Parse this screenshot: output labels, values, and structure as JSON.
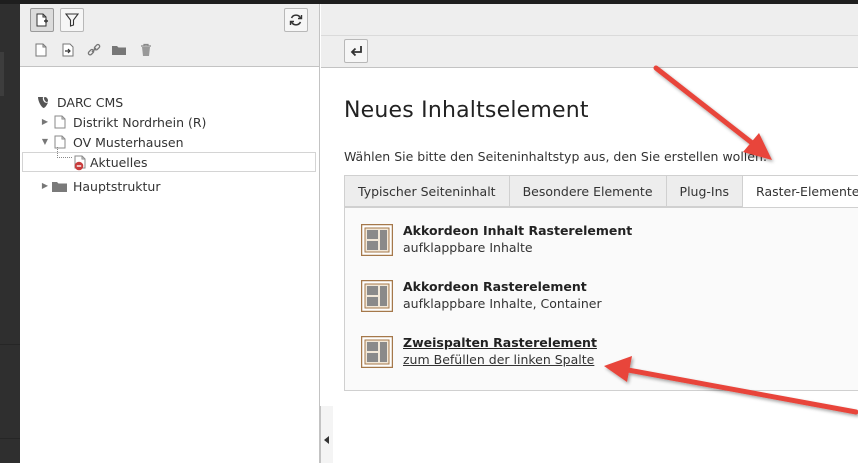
{
  "navigation": {
    "toolbar": {
      "buttons": [
        {
          "icon": "new-page-icon"
        },
        {
          "icon": "filter-icon"
        },
        {
          "icon": "refresh-icon"
        }
      ],
      "small_icons": [
        "page-icon",
        "page-export-icon",
        "link-icon",
        "folder-icon",
        "trash-icon"
      ]
    },
    "tree": {
      "root": "DARC CMS",
      "nodes": [
        {
          "label": "Distrikt Nordrhein (R)"
        },
        {
          "label": "OV Musterhausen"
        },
        {
          "label": "Aktuelles"
        },
        {
          "label": "Hauptstruktur"
        }
      ]
    }
  },
  "content": {
    "title": "Neues Inhaltselement",
    "subtitle": "Wählen Sie bitte den Seiteninhaltstyp aus, den Sie erstellen wollen:",
    "tabs": [
      {
        "label": "Typischer Seiteninhalt"
      },
      {
        "label": "Besondere Elemente"
      },
      {
        "label": "Plug-Ins"
      },
      {
        "label": "Raster-Elemente",
        "active": true
      }
    ],
    "elements": [
      {
        "title": "Akkordeon Inhalt Rasterelement",
        "description": "aufklappbare Inhalte"
      },
      {
        "title": "Akkordeon Rasterelement",
        "description": "aufklappbare Inhalte, Container"
      },
      {
        "title": "Zweispalten Rasterelement",
        "description": "zum Befüllen der linken Spalte"
      }
    ]
  },
  "colors": {
    "annotation_arrow": "#e8443a",
    "icon_frame": "#a5784a",
    "error_badge": "#c83c3c"
  }
}
